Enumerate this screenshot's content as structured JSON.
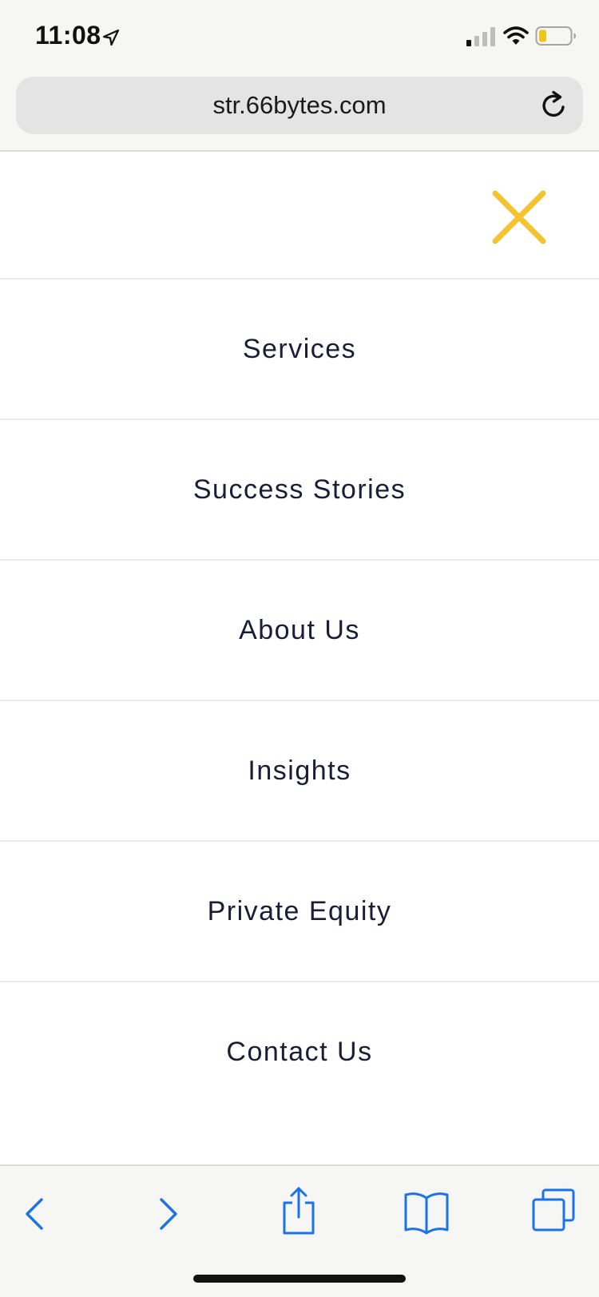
{
  "status_bar": {
    "time": "11:08",
    "location_icon": "location-arrow-icon",
    "signal_icon": "cellular-signal-icon",
    "wifi_icon": "wifi-icon",
    "battery_icon": "battery-low-icon"
  },
  "browser": {
    "url": "str.66bytes.com",
    "reload_icon": "reload-icon"
  },
  "menu": {
    "close_icon": "close-icon",
    "items": [
      {
        "label": "Services"
      },
      {
        "label": "Success Stories"
      },
      {
        "label": "About Us"
      },
      {
        "label": "Insights"
      },
      {
        "label": "Private Equity"
      },
      {
        "label": "Contact Us"
      }
    ]
  },
  "toolbar": {
    "back_icon": "chevron-left-icon",
    "forward_icon": "chevron-right-icon",
    "share_icon": "share-icon",
    "bookmarks_icon": "book-icon",
    "tabs_icon": "tabs-icon"
  },
  "colors": {
    "accent": "#f5c332",
    "menu_text": "#1a1c3a",
    "toolbar_icon": "#1a73e8",
    "battery_level": "#f0c419"
  }
}
